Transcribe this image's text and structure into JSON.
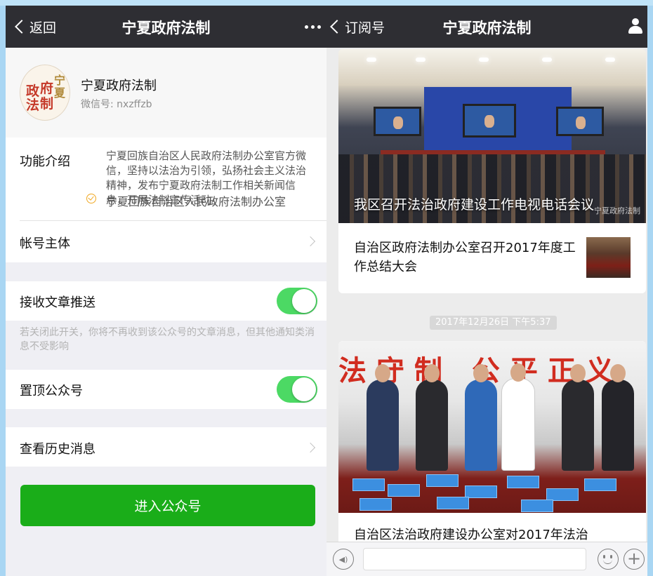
{
  "left": {
    "nav": {
      "back": "返回",
      "title": "宁夏政府法制"
    },
    "profile": {
      "name": "宁夏政府法制",
      "wechat_id": "微信号: nxzffzb",
      "logo_text": "政府法制"
    },
    "intro": {
      "label": "功能介绍",
      "text": "宁夏回族自治区人民政府法制办公室官方微信，坚持以法治为引领，弘扬社会主义法治精神，发布宁夏政府法制工作相关新闻信息，开展法制宣传活动。"
    },
    "entity": {
      "label": "帐号主体",
      "value": "宁夏回族自治区人民政府法制办公室"
    },
    "receive": {
      "label": "接收文章推送",
      "on": true
    },
    "hint": "若关闭此开关，你将不再收到该公众号的文章消息，但其他通知类消息不受影响",
    "pin": {
      "label": "置顶公众号",
      "on": true
    },
    "history": {
      "label": "查看历史消息"
    },
    "enter_button": "进入公众号",
    "colors": {
      "navbar": "#2e2e33",
      "toggle": "#4cd964",
      "button": "#1aad19",
      "verified": "#f0a823"
    }
  },
  "right": {
    "nav": {
      "back": "订阅号",
      "title": "宁夏政府法制",
      "icon": "person-icon"
    },
    "card1": {
      "headline": "我区召开法治政府建设工作电视电话会议",
      "watermark": "宁夏政府法制",
      "sub_article": "自治区政府法制办公室召开2017年度工作总结大会"
    },
    "timestamp": "2017年12月26日 下午5:37",
    "card2": {
      "banner": "法守制 公平正义",
      "headline": "自治区法治政府建设办公室对2017年法治"
    },
    "inputbar": {
      "voice_icon": "voice-icon",
      "emoji_icon": "emoji-icon",
      "plus_icon": "plus-icon"
    }
  }
}
